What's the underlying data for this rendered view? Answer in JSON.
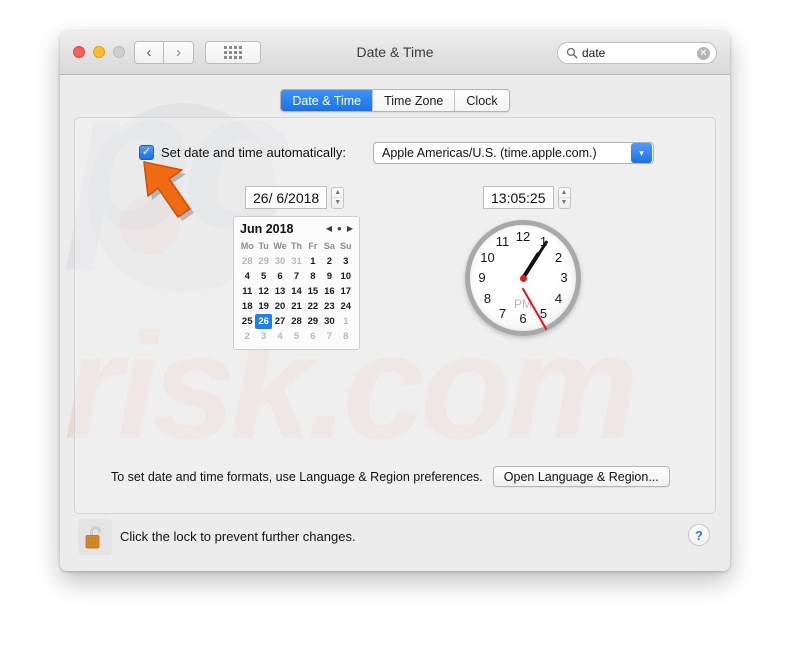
{
  "window": {
    "title": "Date & Time",
    "traffic_lights": [
      "close",
      "minimize",
      "zoom"
    ],
    "nav_back": "‹",
    "nav_forward": "›",
    "grid_icon": "show-all-icon"
  },
  "search": {
    "value": "date",
    "placeholder": "Search",
    "clear_glyph": "✕"
  },
  "tabs": [
    {
      "label": "Date & Time",
      "active": true
    },
    {
      "label": "Time Zone",
      "active": false
    },
    {
      "label": "Clock",
      "active": false
    }
  ],
  "auto": {
    "checked": true,
    "check_glyph": "✓",
    "label": "Set date and time automatically:",
    "server": "Apple Americas/U.S. (time.apple.com.)",
    "chevron": "▾"
  },
  "fields": {
    "date_value": "26/  6/2018",
    "time_value": "13:05:25",
    "stepper_up": "▲",
    "stepper_down": "▼"
  },
  "calendar": {
    "title": "Jun 2018",
    "prev": "◀",
    "today": "●",
    "next": "▶",
    "weekdays": [
      "Mo",
      "Tu",
      "We",
      "Th",
      "Fr",
      "Sa",
      "Su"
    ],
    "weeks": [
      [
        {
          "d": "28",
          "m": "dim"
        },
        {
          "d": "29",
          "m": "dim"
        },
        {
          "d": "30",
          "m": "dim"
        },
        {
          "d": "31",
          "m": "dim"
        },
        {
          "d": "1",
          "m": ""
        },
        {
          "d": "2",
          "m": ""
        },
        {
          "d": "3",
          "m": ""
        }
      ],
      [
        {
          "d": "4",
          "m": ""
        },
        {
          "d": "5",
          "m": ""
        },
        {
          "d": "6",
          "m": ""
        },
        {
          "d": "7",
          "m": ""
        },
        {
          "d": "8",
          "m": ""
        },
        {
          "d": "9",
          "m": ""
        },
        {
          "d": "10",
          "m": ""
        }
      ],
      [
        {
          "d": "11",
          "m": ""
        },
        {
          "d": "12",
          "m": ""
        },
        {
          "d": "13",
          "m": ""
        },
        {
          "d": "14",
          "m": ""
        },
        {
          "d": "15",
          "m": ""
        },
        {
          "d": "16",
          "m": ""
        },
        {
          "d": "17",
          "m": ""
        }
      ],
      [
        {
          "d": "18",
          "m": ""
        },
        {
          "d": "19",
          "m": ""
        },
        {
          "d": "20",
          "m": ""
        },
        {
          "d": "21",
          "m": ""
        },
        {
          "d": "22",
          "m": ""
        },
        {
          "d": "23",
          "m": ""
        },
        {
          "d": "24",
          "m": ""
        }
      ],
      [
        {
          "d": "25",
          "m": ""
        },
        {
          "d": "26",
          "m": "sel"
        },
        {
          "d": "27",
          "m": ""
        },
        {
          "d": "28",
          "m": ""
        },
        {
          "d": "29",
          "m": ""
        },
        {
          "d": "30",
          "m": ""
        },
        {
          "d": "1",
          "m": "dim"
        }
      ],
      [
        {
          "d": "2",
          "m": "dim"
        },
        {
          "d": "3",
          "m": "dim"
        },
        {
          "d": "4",
          "m": "dim"
        },
        {
          "d": "5",
          "m": "dim"
        },
        {
          "d": "6",
          "m": "dim"
        },
        {
          "d": "7",
          "m": "dim"
        },
        {
          "d": "8",
          "m": "dim"
        }
      ]
    ]
  },
  "clock": {
    "numerals": [
      "12",
      "1",
      "2",
      "3",
      "4",
      "5",
      "6",
      "7",
      "8",
      "9",
      "10",
      "11"
    ],
    "meridiem": "PM",
    "hour": 1,
    "minute": 5,
    "second": 25,
    "second_hand_color": "#e61414"
  },
  "format": {
    "text": "To set date and time formats, use Language & Region preferences.",
    "button": "Open Language & Region..."
  },
  "footer": {
    "lock_icon": "unlocked-padlock-icon",
    "lock_text": "Click the lock to prevent further changes.",
    "help": "?"
  },
  "watermark": {
    "line1": "pc",
    "line2": "risk.com"
  },
  "cursor": {
    "kind": "arrow-pointer",
    "color": "#ef6a13"
  }
}
